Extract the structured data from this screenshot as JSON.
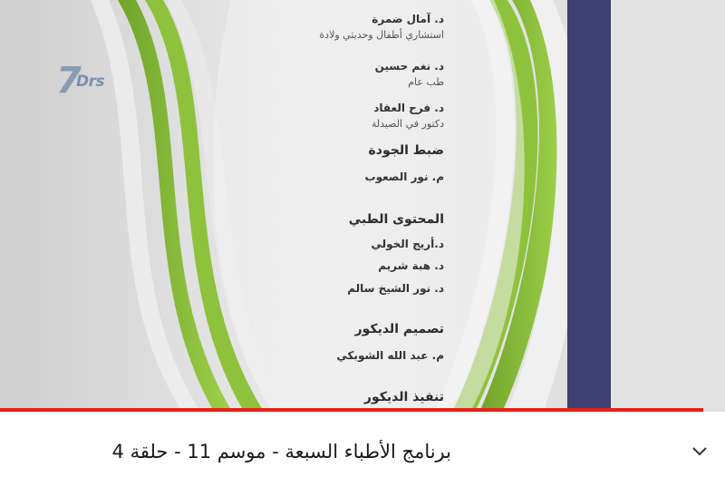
{
  "logo": {
    "mark": "7",
    "text": "Drs"
  },
  "credits": {
    "items": [
      {
        "kind": "name",
        "text": "د. آمال ضمرة"
      },
      {
        "kind": "role",
        "text": "استشاري أطفال وحديثي ولادة"
      },
      {
        "kind": "name",
        "text": "د. نغم حسين"
      },
      {
        "kind": "role",
        "text": "طب عام"
      },
      {
        "kind": "name",
        "text": "د. فرح العقاد"
      },
      {
        "kind": "role",
        "text": "دكتور في الصيدلة"
      },
      {
        "kind": "heading",
        "text": "ضبط الجودة"
      },
      {
        "kind": "name",
        "text": "م. نور الصعوب"
      },
      {
        "kind": "heading",
        "text": "المحتوى الطبي"
      },
      {
        "kind": "name",
        "text": "د.أريج الخولي"
      },
      {
        "kind": "name",
        "text": "د. هبة شريم"
      },
      {
        "kind": "name",
        "text": "د. نور الشيخ سالم"
      },
      {
        "kind": "heading",
        "text": "تصميم الديكور"
      },
      {
        "kind": "name",
        "text": "م. عبد الله الشوبكي"
      },
      {
        "kind": "heading",
        "text": "تنفيذ الديكور"
      }
    ]
  },
  "player": {
    "progress_fraction": 0.97,
    "accent_color": "#e62117"
  },
  "video": {
    "title": "برنامج الأطباء السبعة - موسم 11 - حلقة 4"
  },
  "icons": {
    "expand": "chevron-down-icon"
  }
}
